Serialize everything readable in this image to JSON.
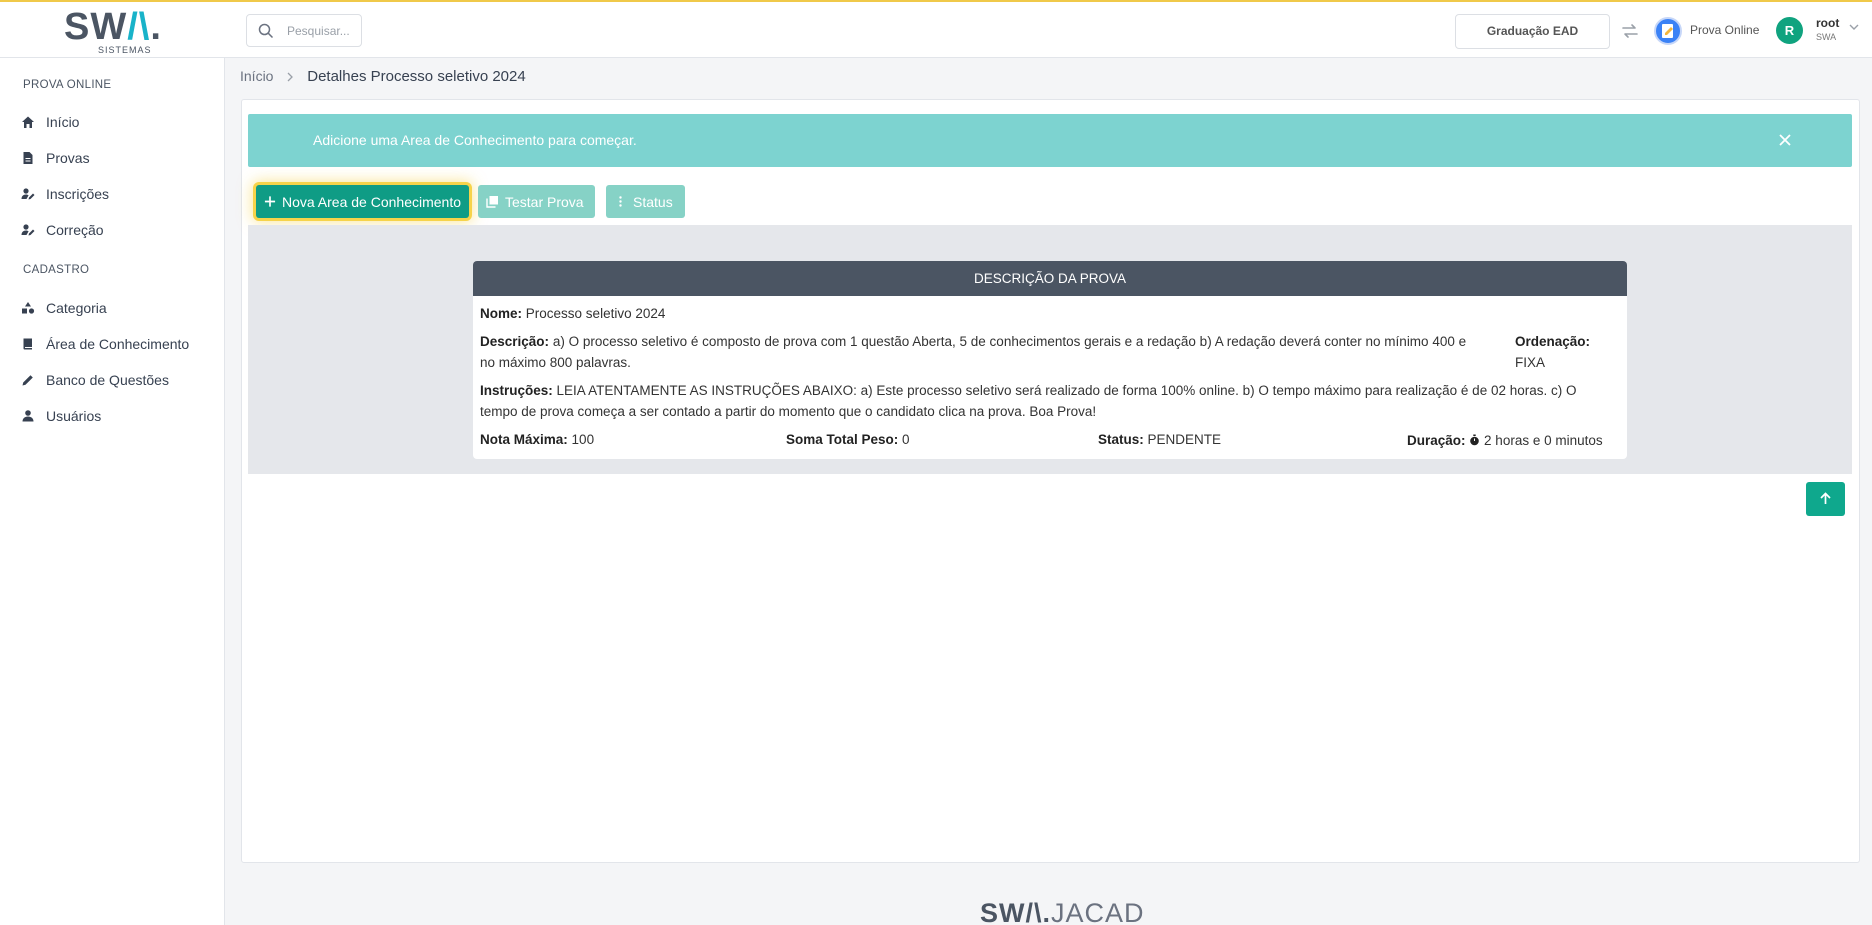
{
  "header": {
    "logo_text_a": "SW",
    "logo_text_b": "/\\",
    "logo_text_c": ".",
    "logo_sub": "SISTEMAS",
    "search_placeholder": "Pesquisar...",
    "course_button": "Graduação EAD",
    "app_label": "Prova Online",
    "avatar_letter": "R",
    "user_name": "root",
    "user_org": "SWA"
  },
  "sidebar": {
    "section_1": "PROVA ONLINE",
    "items_1": [
      {
        "label": "Início",
        "icon": "home-icon"
      },
      {
        "label": "Provas",
        "icon": "document-icon"
      },
      {
        "label": "Inscrições",
        "icon": "user-edit-icon"
      },
      {
        "label": "Correção",
        "icon": "user-edit-icon"
      }
    ],
    "section_2": "CADASTRO",
    "items_2": [
      {
        "label": "Categoria",
        "icon": "shapes-icon"
      },
      {
        "label": "Área de Conhecimento",
        "icon": "book-icon"
      },
      {
        "label": "Banco de Questões",
        "icon": "pencil-icon"
      },
      {
        "label": "Usuários",
        "icon": "user-icon"
      }
    ]
  },
  "breadcrumb": {
    "home": "Início",
    "current": "Detalhes Processo seletivo 2024"
  },
  "alert": {
    "text": "Adicione uma Area de Conhecimento para começar."
  },
  "toolbar": {
    "new_area": "Nova Area de Conhecimento",
    "test_exam": "Testar Prova",
    "status": "Status"
  },
  "exam": {
    "header": "DESCRIÇÃO DA PROVA",
    "name_label": "Nome:",
    "name": "Processo seletivo 2024",
    "description_label": "Descrição:",
    "description_line1": "a) O processo seletivo é composto de prova com 1 questão Aberta, 5 de conhecimentos gerais e a redação b) A redação deverá conter no mínimo 400 e",
    "description_line2": "no máximo 800 palavras.",
    "ordering_label": "Ordenação:",
    "ordering": "FIXA",
    "instructions_label": "Instruções:",
    "instructions_line1": "LEIA ATENTAMENTE AS INSTRUÇÕES ABAIXO: a) Este processo seletivo será realizado de forma 100% online. b) O tempo máximo para realização é de 02 horas. c) O",
    "instructions_line2": "tempo de prova começa a ser contado a partir do momento que o candidato clica na prova. Boa Prova!",
    "max_score_label": "Nota Máxima:",
    "max_score": "100",
    "weight_label": "Soma Total Peso:",
    "weight": "0",
    "status_label": "Status:",
    "status": "PENDENTE",
    "duration_label": "Duração:",
    "duration": "2 horas e 0 minutos"
  },
  "footer": {
    "brand_a": "SW/\\.",
    "brand_b": "JACAD"
  },
  "colors": {
    "primary": "#0f9c85",
    "alert_bg": "#7dd3d0",
    "card_header": "#4b5563",
    "highlight": "#f6d34a"
  }
}
